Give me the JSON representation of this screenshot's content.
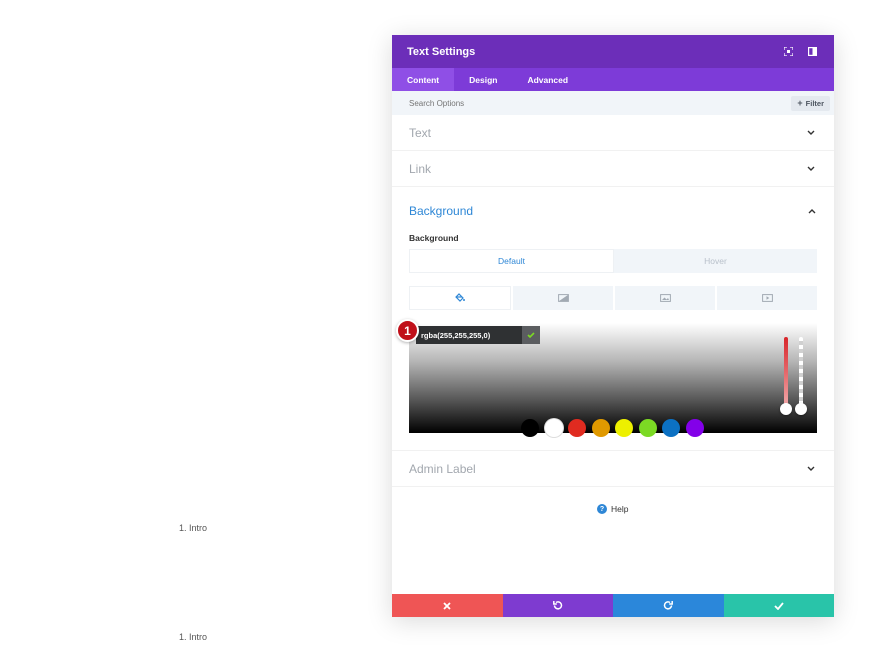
{
  "background_page": {
    "list_items": [
      {
        "text": "1. Intro"
      },
      {
        "text": "1. Intro"
      }
    ]
  },
  "modal": {
    "title": "Text Settings",
    "header_icons": [
      "fullscreen-icon",
      "sidebar-toggle-icon"
    ],
    "tabs": [
      {
        "label": "Content",
        "active": true
      },
      {
        "label": "Design",
        "active": false
      },
      {
        "label": "Advanced",
        "active": false
      }
    ],
    "search": {
      "placeholder": "Search Options",
      "filter_label": "Filter"
    },
    "sections": {
      "text": {
        "title": "Text",
        "expanded": false
      },
      "link": {
        "title": "Link",
        "expanded": false
      },
      "background": {
        "title": "Background",
        "expanded": true,
        "field_label": "Background",
        "state_toggle": [
          {
            "label": "Default",
            "active": true
          },
          {
            "label": "Hover",
            "active": false
          }
        ],
        "type_tabs": [
          "paint-bucket-icon",
          "gradient-icon",
          "image-icon",
          "video-icon"
        ],
        "color_value": "rgba(255,255,255,0)",
        "swatches": [
          "#000000",
          "#ffffff",
          "#e02b20",
          "#e09900",
          "#edf000",
          "#7cda24",
          "#0c71c3",
          "#8300e9"
        ]
      },
      "admin_label": {
        "title": "Admin Label",
        "expanded": false
      }
    },
    "help_label": "Help",
    "footer": [
      {
        "name": "cancel",
        "icon": "close-icon",
        "color": "#ef5555"
      },
      {
        "name": "undo",
        "icon": "undo-icon",
        "color": "#7e3bd0"
      },
      {
        "name": "redo",
        "icon": "redo-icon",
        "color": "#2b87da"
      },
      {
        "name": "save",
        "icon": "check-icon",
        "color": "#29c4a9"
      }
    ]
  },
  "annotation_badge": "1",
  "colors": {
    "header": "#6c2eb9",
    "tabs": "#7d3bd8",
    "accent": "#2e87d6"
  }
}
